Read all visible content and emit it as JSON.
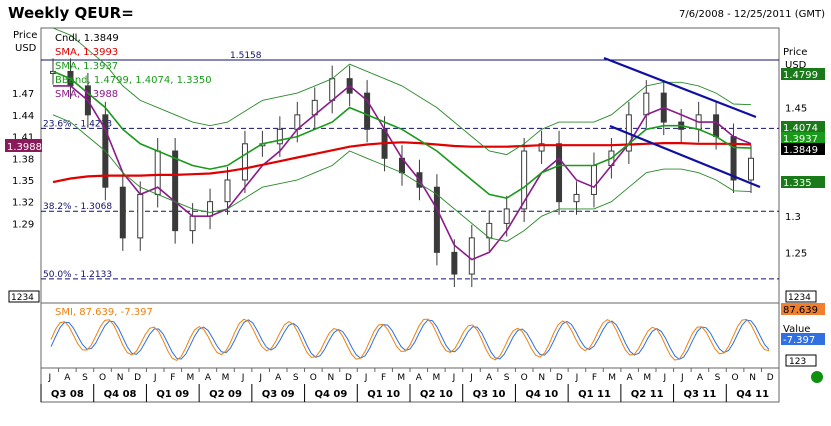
{
  "title": "Weekly QEUR=",
  "date_range": "7/6/2008 - 12/25/2011 (GMT)",
  "colors": {
    "price": "#3a3a3a",
    "sma_fast": "#8b1a8b",
    "sma_slow": "#e00000",
    "sma_mid": "#1a9a1a",
    "bband": "#2a8a2a",
    "trend": "#1010a0",
    "smi": "#f08010",
    "smi_signal": "#3070e0",
    "ref_line": "#101070",
    "status_dot": "#109010"
  },
  "panels": {
    "main": {
      "left_axis_header": [
        "Price",
        "USD"
      ],
      "right_axis_header": [
        "Price",
        "USD"
      ],
      "left_ticks": [
        "1.47",
        "1.44",
        "1.41",
        "1.38",
        "1.35",
        "1.32",
        "1.29"
      ],
      "right_ticks": [
        "1.45",
        "1.35",
        "1.3",
        "1.25"
      ],
      "bottom_badge": "1234",
      "legend": [
        {
          "text": "Cndl, 1.3849",
          "color": "#000000"
        },
        {
          "text": "SMA, 1.3993",
          "color": "#e00000"
        },
        {
          "text": "SMA, 1.3937",
          "color": "#1a9a1a"
        },
        {
          "text": "BBand, 1.4799, 1.4074, 1.3350",
          "color": "#1a9a1a"
        },
        {
          "text": "SMA, 1.3988",
          "color": "#8b1a8b"
        }
      ],
      "right_value_badges": [
        {
          "text": "1.4799",
          "bg": "#1a7a1a",
          "fg": "#ffffff"
        },
        {
          "text": "1.4074",
          "bg": "#1a7a1a",
          "fg": "#ffffff"
        },
        {
          "text": "1.3937",
          "bg": "#1a9a1a",
          "fg": "#ffffff"
        },
        {
          "text": "1.3849",
          "bg": "#000000",
          "fg": "#ffffff"
        },
        {
          "text": "1.335",
          "bg": "#1a7a1a",
          "fg": "#ffffff"
        }
      ],
      "left_value_badge": {
        "text": "1.3988",
        "bg": "#8b1a5a",
        "fg": "#ffffff"
      },
      "ref_lines": [
        {
          "label": "1.5158",
          "value": 1.5158,
          "style": "solid"
        },
        {
          "label": "23.6% - 1.4213",
          "value": 1.4213,
          "style": "dashed"
        },
        {
          "label": "38.2% - 1.3068",
          "value": 1.3068,
          "style": "dashed"
        },
        {
          "label": "50.0% - 1.2133",
          "value": 1.2133,
          "style": "dashed"
        }
      ]
    },
    "smi": {
      "legend": "SMI, 87.639, -7.397",
      "right_header": [
        "Value",
        "USD"
      ],
      "right_value_badges": [
        {
          "text": "87.639",
          "bg": "#f08030",
          "fg": "#000000"
        },
        {
          "text": "-7.397",
          "bg": "#3070e0",
          "fg": "#ffffff"
        }
      ],
      "bottom_badge": "123"
    }
  },
  "x_axis": {
    "months": [
      "J",
      "A",
      "S",
      "O",
      "N",
      "D",
      "J",
      "F",
      "M",
      "A",
      "M",
      "J",
      "J",
      "A",
      "S",
      "O",
      "N",
      "D",
      "J",
      "F",
      "M",
      "A",
      "M",
      "J",
      "J",
      "A",
      "S",
      "O",
      "N",
      "D",
      "J",
      "F",
      "M",
      "A",
      "M",
      "J",
      "J",
      "A",
      "S",
      "O",
      "N",
      "D"
    ],
    "quarters": [
      "Q3 08",
      "Q4 08",
      "Q1 09",
      "Q2 09",
      "Q3 09",
      "Q4 09",
      "Q1 10",
      "Q2 10",
      "Q3 10",
      "Q4 10",
      "Q1 11",
      "Q2 11",
      "Q3 11",
      "Q4 11"
    ]
  },
  "chart_data": {
    "type": "line",
    "title": "Weekly QEUR=",
    "x_range": [
      "2008-07",
      "2011-12"
    ],
    "ylim": [
      1.18,
      1.56
    ],
    "ylabel": "Price USD",
    "grid": false,
    "x": [
      "2008-07",
      "2008-08",
      "2008-09",
      "2008-10",
      "2008-11",
      "2008-12",
      "2009-01",
      "2009-02",
      "2009-03",
      "2009-04",
      "2009-05",
      "2009-06",
      "2009-07",
      "2009-08",
      "2009-09",
      "2009-10",
      "2009-11",
      "2009-12",
      "2010-01",
      "2010-02",
      "2010-03",
      "2010-04",
      "2010-05",
      "2010-06",
      "2010-07",
      "2010-08",
      "2010-09",
      "2010-10",
      "2010-11",
      "2010-12",
      "2011-01",
      "2011-02",
      "2011-03",
      "2011-04",
      "2011-05",
      "2011-06",
      "2011-07",
      "2011-08",
      "2011-09",
      "2011-10",
      "2011-11"
    ],
    "series": [
      {
        "name": "Cndl",
        "values": [
          1.5,
          1.48,
          1.44,
          1.34,
          1.27,
          1.33,
          1.39,
          1.28,
          1.3,
          1.32,
          1.35,
          1.4,
          1.4,
          1.42,
          1.44,
          1.46,
          1.49,
          1.47,
          1.42,
          1.38,
          1.36,
          1.34,
          1.25,
          1.22,
          1.27,
          1.29,
          1.31,
          1.39,
          1.4,
          1.32,
          1.33,
          1.37,
          1.39,
          1.44,
          1.47,
          1.43,
          1.42,
          1.44,
          1.41,
          1.35,
          1.38
        ]
      },
      {
        "name": "SMA",
        "values": [
          1.48,
          1.48,
          1.46,
          1.42,
          1.36,
          1.33,
          1.34,
          1.32,
          1.3,
          1.3,
          1.31,
          1.34,
          1.37,
          1.39,
          1.42,
          1.44,
          1.46,
          1.48,
          1.46,
          1.42,
          1.38,
          1.35,
          1.31,
          1.26,
          1.24,
          1.25,
          1.28,
          1.32,
          1.36,
          1.38,
          1.35,
          1.34,
          1.37,
          1.4,
          1.44,
          1.45,
          1.44,
          1.43,
          1.43,
          1.41,
          1.4
        ]
      },
      {
        "name": "SMA",
        "values": [
          1.347,
          1.352,
          1.355,
          1.356,
          1.356,
          1.356,
          1.357,
          1.357,
          1.358,
          1.359,
          1.362,
          1.366,
          1.371,
          1.376,
          1.381,
          1.386,
          1.391,
          1.396,
          1.399,
          1.401,
          1.402,
          1.401,
          1.399,
          1.397,
          1.396,
          1.396,
          1.396,
          1.397,
          1.398,
          1.398,
          1.398,
          1.398,
          1.398,
          1.399,
          1.4,
          1.401,
          1.401,
          1.4,
          1.4,
          1.4,
          1.399
        ]
      },
      {
        "name": "SMA",
        "values": [
          1.5,
          1.49,
          1.47,
          1.45,
          1.42,
          1.4,
          1.39,
          1.38,
          1.37,
          1.365,
          1.37,
          1.385,
          1.4,
          1.405,
          1.41,
          1.42,
          1.43,
          1.45,
          1.44,
          1.43,
          1.42,
          1.405,
          1.39,
          1.37,
          1.35,
          1.33,
          1.325,
          1.34,
          1.36,
          1.37,
          1.37,
          1.37,
          1.38,
          1.4,
          1.42,
          1.425,
          1.425,
          1.42,
          1.41,
          1.395,
          1.394
        ]
      }
    ]
  }
}
